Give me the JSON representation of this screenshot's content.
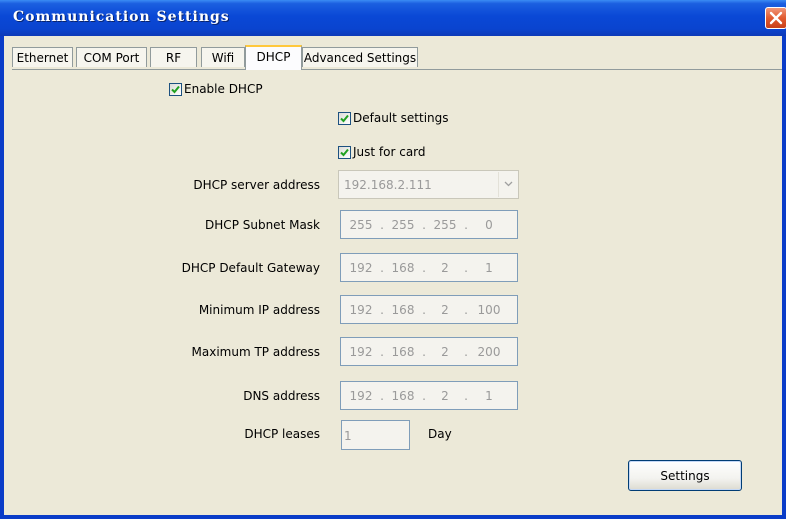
{
  "window": {
    "title": "Communication Settings"
  },
  "tabs": [
    {
      "label": "Ethernet"
    },
    {
      "label": "COM Port"
    },
    {
      "label": "RF"
    },
    {
      "label": "Wifi"
    },
    {
      "label": "DHCP",
      "active": true
    },
    {
      "label": "Advanced Settings"
    }
  ],
  "dhcp": {
    "enable_label": "Enable DHCP",
    "enable_checked": true,
    "default_label": "Default settings",
    "default_checked": true,
    "card_label": "Just for card",
    "card_checked": true,
    "server_label": "DHCP server address",
    "server_value": "192.168.2.111",
    "subnet_label": "DHCP Subnet Mask",
    "subnet": [
      "255",
      "255",
      "255",
      "0"
    ],
    "gateway_label": "DHCP Default Gateway",
    "gateway": [
      "192",
      "168",
      "2",
      "1"
    ],
    "min_ip_label": "Minimum IP address",
    "min_ip": [
      "192",
      "168",
      "2",
      "100"
    ],
    "max_ip_label": "Maximum TP address",
    "max_ip": [
      "192",
      "168",
      "2",
      "200"
    ],
    "dns_label": "DNS address",
    "dns": [
      "192",
      "168",
      "2",
      "1"
    ],
    "leases_label": "DHCP leases",
    "leases_value": "1",
    "leases_unit": "Day",
    "ip_separator": ".",
    "settings_button": "Settings"
  },
  "colors": {
    "titlebar": "#0a48d6",
    "close": "#e15b30",
    "active_tab_highlight": "#ffc83c",
    "check": "#21a121"
  },
  "icons": {
    "close": "close-icon",
    "check": "checkmark-icon",
    "dropdown": "chevron-down-icon"
  }
}
